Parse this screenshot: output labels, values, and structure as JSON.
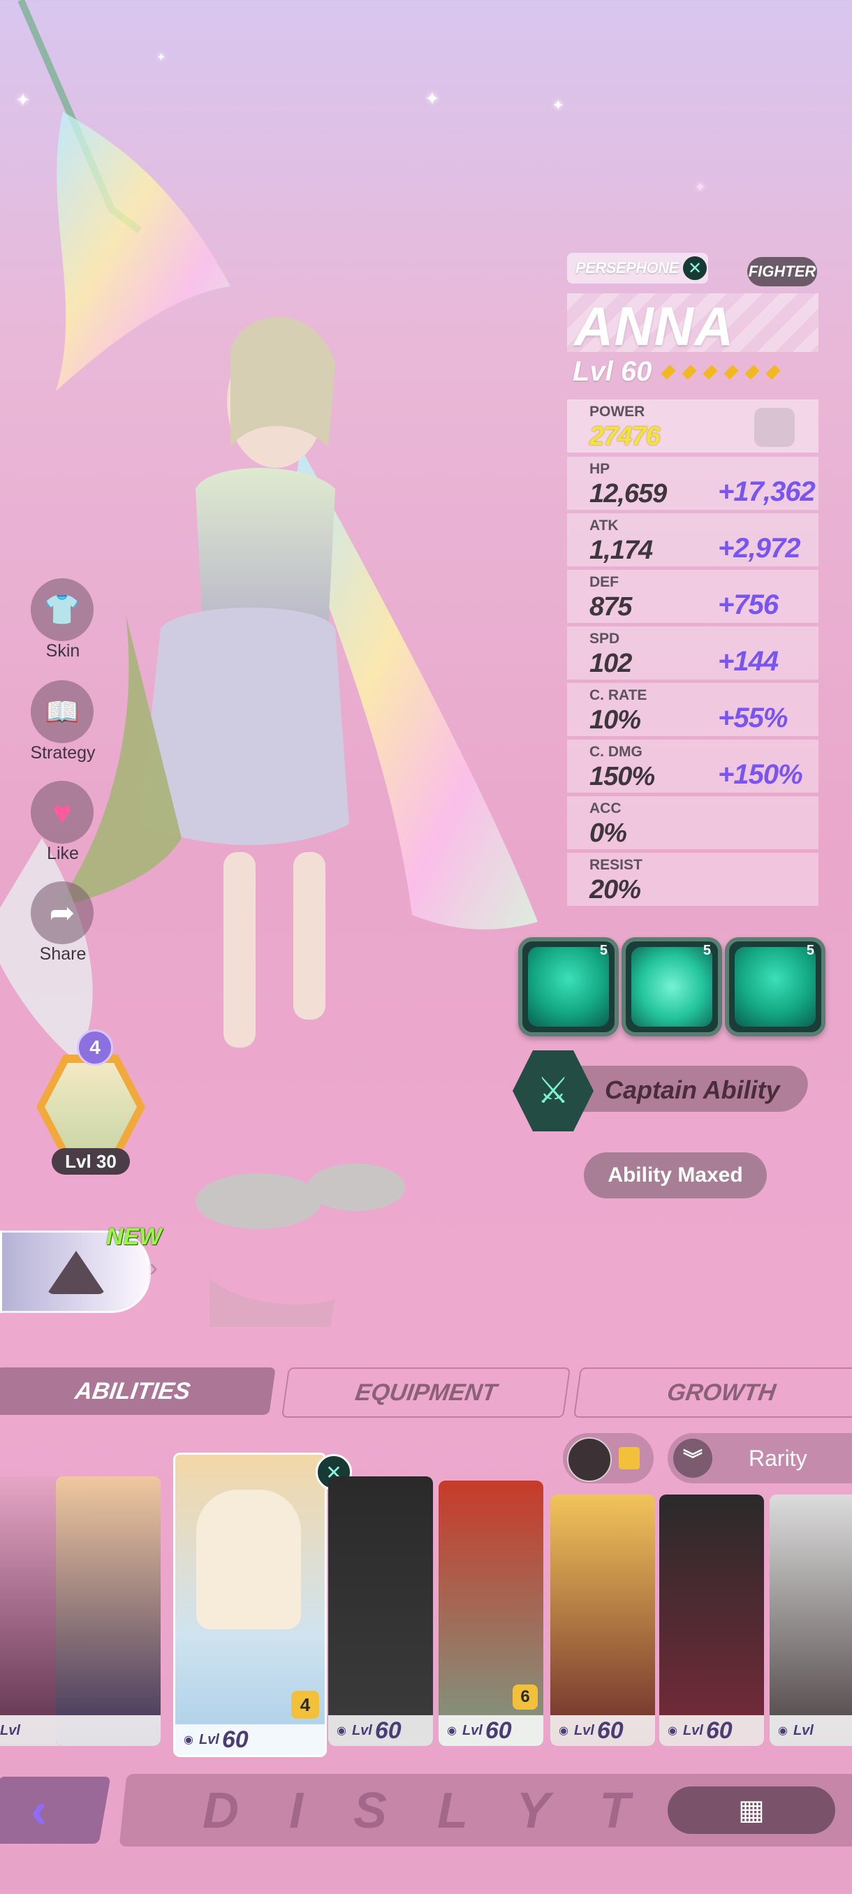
{
  "hero": {
    "faction": "PERSEPHONE",
    "role": "FIGHTER",
    "name": "ANNA",
    "level_label": "Lvl 60",
    "star_count": 6
  },
  "stats": [
    {
      "label": "POWER",
      "value": "27476",
      "bonus": ""
    },
    {
      "label": "HP",
      "value": "12,659",
      "bonus": "+17,362"
    },
    {
      "label": "ATK",
      "value": "1,174",
      "bonus": "+2,972"
    },
    {
      "label": "DEF",
      "value": "875",
      "bonus": "+756"
    },
    {
      "label": "SPD",
      "value": "102",
      "bonus": "+144"
    },
    {
      "label": "C. RATE",
      "value": "10%",
      "bonus": "+55%"
    },
    {
      "label": "C. DMG",
      "value": "150%",
      "bonus": "+150%"
    },
    {
      "label": "ACC",
      "value": "0%",
      "bonus": ""
    },
    {
      "label": "RESIST",
      "value": "20%",
      "bonus": ""
    }
  ],
  "side_menu": {
    "skin": "Skin",
    "strategy": "Strategy",
    "like": "Like",
    "share": "Share"
  },
  "companion": {
    "badge": "4",
    "level": "Lvl 30"
  },
  "new_badge": "NEW",
  "skills": [
    {
      "icon": "slash-skill-icon",
      "level": "5"
    },
    {
      "icon": "vortex-skill-icon",
      "level": "5"
    },
    {
      "icon": "vines-skill-icon",
      "level": "5"
    }
  ],
  "captain_ability": "Captain Ability",
  "ability_status": "Ability Maxed",
  "tabs": [
    "ABILITIES",
    "EQUIPMENT",
    "GROWTH"
  ],
  "sort": {
    "label": "Rarity"
  },
  "roster": [
    {
      "level": "Lvl",
      "num": "",
      "badge": ""
    },
    {
      "level": "",
      "num": "",
      "badge": ""
    },
    {
      "level": "Lvl",
      "num": "60",
      "badge": "4"
    },
    {
      "level": "Lvl",
      "num": "60",
      "badge": ""
    },
    {
      "level": "Lvl",
      "num": "60",
      "badge": "6"
    },
    {
      "level": "Lvl",
      "num": "60",
      "badge": ""
    },
    {
      "level": "Lvl",
      "num": "60",
      "badge": ""
    },
    {
      "level": "Lvl",
      "num": "",
      "badge": ""
    }
  ],
  "footer": {
    "brand": "D I S L Y T"
  },
  "colors": {
    "accent": "#7755ee",
    "skill": "#13a783",
    "power": "#f5e23a"
  }
}
